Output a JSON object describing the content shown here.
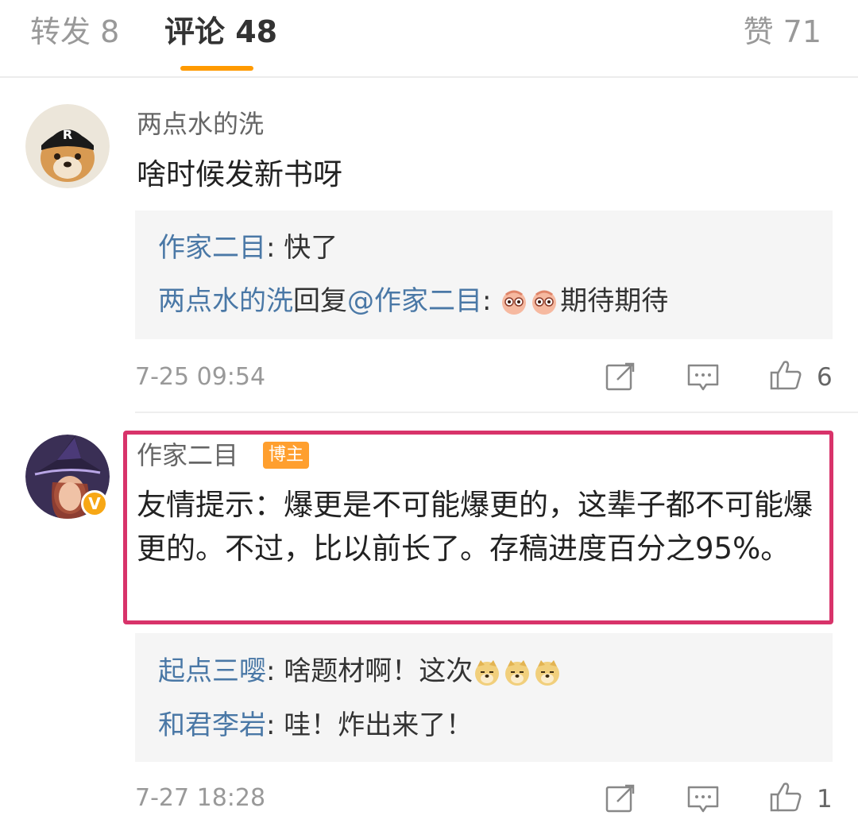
{
  "tabs": {
    "repost": "转发 8",
    "comments": "评论 48",
    "likes": "赞 71"
  },
  "comments": [
    {
      "author": "两点水的洗",
      "text": "啥时候发新书呀",
      "replies": [
        {
          "name": "作家二目",
          "sep": ": ",
          "content": "快了"
        },
        {
          "name": "两点水的洗",
          "mid": "回复",
          "target": "@作家二目",
          "sep": ":",
          "content": "期待期待"
        }
      ],
      "time": "7-25 09:54",
      "likes": "6"
    },
    {
      "author": "作家二目",
      "badge": "博主",
      "verified_mark": "V",
      "text": "友情提示：爆更是不可能爆更的，这辈子都不可能爆更的。不过，比以前长了。存稿进度百分之95%。",
      "replies": [
        {
          "name": "起点三嘤",
          "sep": ": ",
          "content": "啥题材啊！这次"
        },
        {
          "name": "和君李岩",
          "sep": ": ",
          "content": "哇！炸出来了！"
        }
      ],
      "time": "7-27 18:28",
      "likes": "1"
    }
  ],
  "icons": {
    "share": "share-icon",
    "comment": "comment-icon",
    "like": "thumbs-up-icon",
    "emoji_1": "doll-face-emoji",
    "emoji_2": "doge-emoji"
  },
  "colors": {
    "accent": "#ff9a00",
    "link": "#4a78a6",
    "highlight": "#d8336a",
    "badge": "#ff9f2e"
  }
}
